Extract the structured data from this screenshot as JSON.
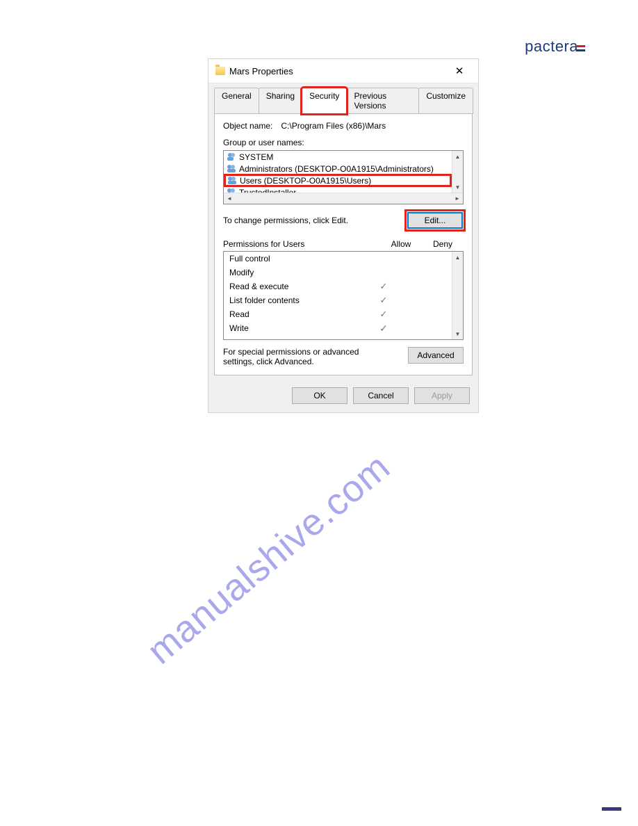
{
  "logo_text": "pactera",
  "watermark": "manualshive.com",
  "dialog": {
    "title": "Mars Properties",
    "tabs": [
      "General",
      "Sharing",
      "Security",
      "Previous Versions",
      "Customize"
    ],
    "active_tab": "Security",
    "object_name_label": "Object name:",
    "object_name_value": "C:\\Program Files (x86)\\Mars",
    "group_label": "Group or user names:",
    "groups": [
      {
        "name": "SYSTEM",
        "highlight": false
      },
      {
        "name": "Administrators (DESKTOP-O0A1915\\Administrators)",
        "highlight": false
      },
      {
        "name": "Users (DESKTOP-O0A1915\\Users)",
        "highlight": true
      },
      {
        "name": "TrustedInstaller",
        "highlight": false
      }
    ],
    "change_label": "To change permissions, click Edit.",
    "edit_button": "Edit...",
    "perm_header": "Permissions for Users",
    "allow_col": "Allow",
    "deny_col": "Deny",
    "permissions": [
      {
        "name": "Full control",
        "allow": "",
        "deny": ""
      },
      {
        "name": "Modify",
        "allow": "",
        "deny": ""
      },
      {
        "name": "Read & execute",
        "allow": "grey",
        "deny": ""
      },
      {
        "name": "List folder contents",
        "allow": "grey",
        "deny": ""
      },
      {
        "name": "Read",
        "allow": "grey",
        "deny": ""
      },
      {
        "name": "Write",
        "allow": "check",
        "deny": ""
      }
    ],
    "adv_label": "For special permissions or advanced settings, click Advanced.",
    "advanced_button": "Advanced",
    "ok_button": "OK",
    "cancel_button": "Cancel",
    "apply_button": "Apply"
  }
}
